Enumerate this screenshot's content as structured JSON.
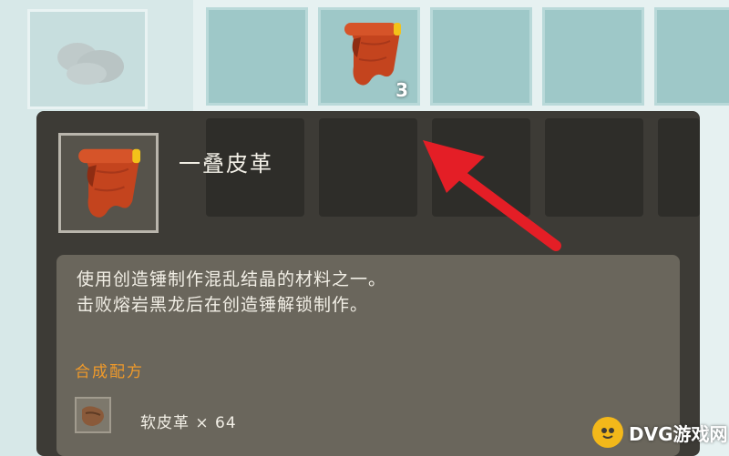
{
  "inventory": {
    "top_slot_item": "leather-roll",
    "top_slot_count": "3"
  },
  "tooltip": {
    "item_name": "一叠皮革",
    "description_lines": [
      "使用创造锤制作混乱结晶的材料之一。",
      "击败熔岩黑龙后在创造锤解锁制作。"
    ],
    "recipe_title": "合成配方",
    "recipe_item": "软皮革 × 64"
  },
  "annotation": {
    "arrow_color": "#e41e26"
  },
  "watermark": {
    "text": "DVG游戏网"
  },
  "colors": {
    "tooltip_bg": "#3d3b36",
    "desc_bg": "#6a665c",
    "recipe_title": "#f09a2a",
    "slot_teal": "#9ec8c8"
  }
}
